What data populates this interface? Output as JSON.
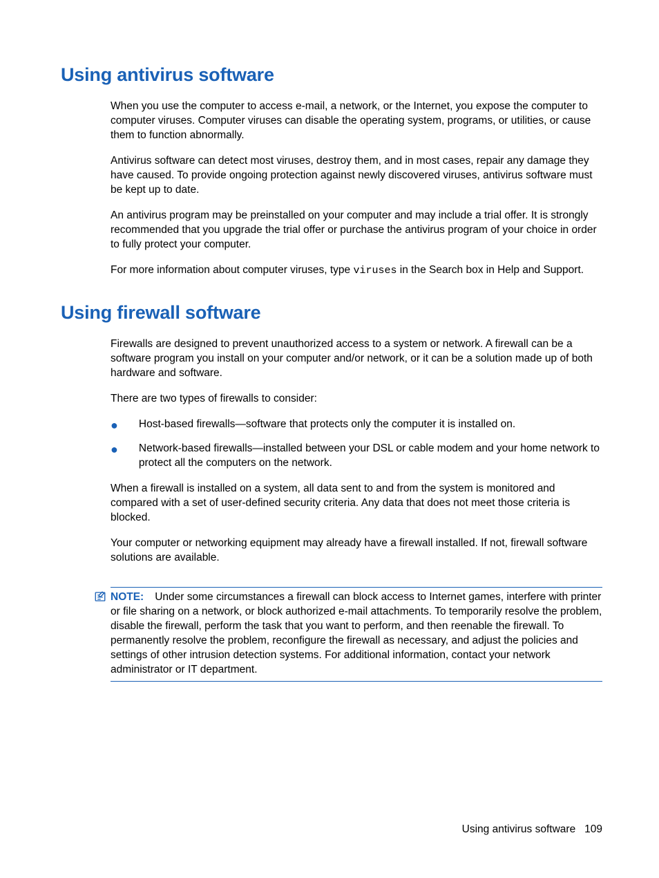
{
  "section1": {
    "heading": "Using antivirus software",
    "p1": "When you use the computer to access e-mail, a network, or the Internet, you expose the computer to computer viruses. Computer viruses can disable the operating system, programs, or utilities, or cause them to function abnormally.",
    "p2": "Antivirus software can detect most viruses, destroy them, and in most cases, repair any damage they have caused. To provide ongoing protection against newly discovered viruses, antivirus software must be kept up to date.",
    "p3": "An antivirus program may be preinstalled on your computer and may include a trial offer. It is strongly recommended that you upgrade the trial offer or purchase the antivirus program of your choice in order to fully protect your computer.",
    "p4a": "For more information about computer viruses, type ",
    "p4_code": "viruses",
    "p4b": " in the Search box in Help and Support."
  },
  "section2": {
    "heading": "Using firewall software",
    "p1": "Firewalls are designed to prevent unauthorized access to a system or network. A firewall can be a software program you install on your computer and/or network, or it can be a solution made up of both hardware and software.",
    "p2": "There are two types of firewalls to consider:",
    "bullets": [
      "Host-based firewalls—software that protects only the computer it is installed on.",
      "Network-based firewalls—installed between your DSL or cable modem and your home network to protect all the computers on the network."
    ],
    "p3": "When a firewall is installed on a system, all data sent to and from the system is monitored and compared with a set of user-defined security criteria. Any data that does not meet those criteria is blocked.",
    "p4": "Your computer or networking equipment may already have a firewall installed. If not, firewall software solutions are available.",
    "note_label": "NOTE:",
    "note_body": "Under some circumstances a firewall can block access to Internet games, interfere with printer or file sharing on a network, or block authorized e-mail attachments. To temporarily resolve the problem, disable the firewall, perform the task that you want to perform, and then reenable the firewall. To permanently resolve the problem, reconfigure the firewall as necessary, and adjust the policies and settings of other intrusion detection systems. For additional information, contact your network administrator or IT department."
  },
  "footer": {
    "title": "Using antivirus software",
    "page": "109"
  }
}
